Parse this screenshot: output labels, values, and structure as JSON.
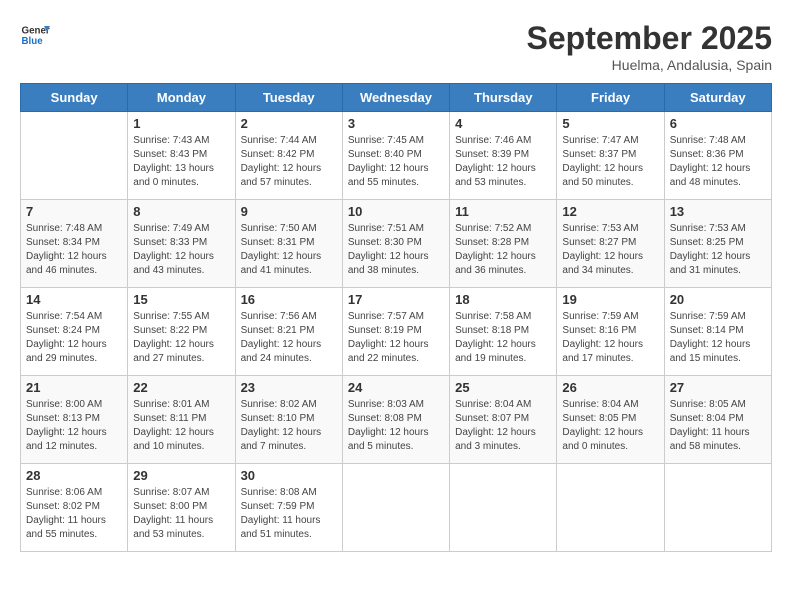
{
  "logo": {
    "line1": "General",
    "line2": "Blue"
  },
  "title": "September 2025",
  "subtitle": "Huelma, Andalusia, Spain",
  "days_header": [
    "Sunday",
    "Monday",
    "Tuesday",
    "Wednesday",
    "Thursday",
    "Friday",
    "Saturday"
  ],
  "weeks": [
    [
      {
        "day": "",
        "sunrise": "",
        "sunset": "",
        "daylight": ""
      },
      {
        "day": "1",
        "sunrise": "Sunrise: 7:43 AM",
        "sunset": "Sunset: 8:43 PM",
        "daylight": "Daylight: 13 hours and 0 minutes."
      },
      {
        "day": "2",
        "sunrise": "Sunrise: 7:44 AM",
        "sunset": "Sunset: 8:42 PM",
        "daylight": "Daylight: 12 hours and 57 minutes."
      },
      {
        "day": "3",
        "sunrise": "Sunrise: 7:45 AM",
        "sunset": "Sunset: 8:40 PM",
        "daylight": "Daylight: 12 hours and 55 minutes."
      },
      {
        "day": "4",
        "sunrise": "Sunrise: 7:46 AM",
        "sunset": "Sunset: 8:39 PM",
        "daylight": "Daylight: 12 hours and 53 minutes."
      },
      {
        "day": "5",
        "sunrise": "Sunrise: 7:47 AM",
        "sunset": "Sunset: 8:37 PM",
        "daylight": "Daylight: 12 hours and 50 minutes."
      },
      {
        "day": "6",
        "sunrise": "Sunrise: 7:48 AM",
        "sunset": "Sunset: 8:36 PM",
        "daylight": "Daylight: 12 hours and 48 minutes."
      }
    ],
    [
      {
        "day": "7",
        "sunrise": "Sunrise: 7:48 AM",
        "sunset": "Sunset: 8:34 PM",
        "daylight": "Daylight: 12 hours and 46 minutes."
      },
      {
        "day": "8",
        "sunrise": "Sunrise: 7:49 AM",
        "sunset": "Sunset: 8:33 PM",
        "daylight": "Daylight: 12 hours and 43 minutes."
      },
      {
        "day": "9",
        "sunrise": "Sunrise: 7:50 AM",
        "sunset": "Sunset: 8:31 PM",
        "daylight": "Daylight: 12 hours and 41 minutes."
      },
      {
        "day": "10",
        "sunrise": "Sunrise: 7:51 AM",
        "sunset": "Sunset: 8:30 PM",
        "daylight": "Daylight: 12 hours and 38 minutes."
      },
      {
        "day": "11",
        "sunrise": "Sunrise: 7:52 AM",
        "sunset": "Sunset: 8:28 PM",
        "daylight": "Daylight: 12 hours and 36 minutes."
      },
      {
        "day": "12",
        "sunrise": "Sunrise: 7:53 AM",
        "sunset": "Sunset: 8:27 PM",
        "daylight": "Daylight: 12 hours and 34 minutes."
      },
      {
        "day": "13",
        "sunrise": "Sunrise: 7:53 AM",
        "sunset": "Sunset: 8:25 PM",
        "daylight": "Daylight: 12 hours and 31 minutes."
      }
    ],
    [
      {
        "day": "14",
        "sunrise": "Sunrise: 7:54 AM",
        "sunset": "Sunset: 8:24 PM",
        "daylight": "Daylight: 12 hours and 29 minutes."
      },
      {
        "day": "15",
        "sunrise": "Sunrise: 7:55 AM",
        "sunset": "Sunset: 8:22 PM",
        "daylight": "Daylight: 12 hours and 27 minutes."
      },
      {
        "day": "16",
        "sunrise": "Sunrise: 7:56 AM",
        "sunset": "Sunset: 8:21 PM",
        "daylight": "Daylight: 12 hours and 24 minutes."
      },
      {
        "day": "17",
        "sunrise": "Sunrise: 7:57 AM",
        "sunset": "Sunset: 8:19 PM",
        "daylight": "Daylight: 12 hours and 22 minutes."
      },
      {
        "day": "18",
        "sunrise": "Sunrise: 7:58 AM",
        "sunset": "Sunset: 8:18 PM",
        "daylight": "Daylight: 12 hours and 19 minutes."
      },
      {
        "day": "19",
        "sunrise": "Sunrise: 7:59 AM",
        "sunset": "Sunset: 8:16 PM",
        "daylight": "Daylight: 12 hours and 17 minutes."
      },
      {
        "day": "20",
        "sunrise": "Sunrise: 7:59 AM",
        "sunset": "Sunset: 8:14 PM",
        "daylight": "Daylight: 12 hours and 15 minutes."
      }
    ],
    [
      {
        "day": "21",
        "sunrise": "Sunrise: 8:00 AM",
        "sunset": "Sunset: 8:13 PM",
        "daylight": "Daylight: 12 hours and 12 minutes."
      },
      {
        "day": "22",
        "sunrise": "Sunrise: 8:01 AM",
        "sunset": "Sunset: 8:11 PM",
        "daylight": "Daylight: 12 hours and 10 minutes."
      },
      {
        "day": "23",
        "sunrise": "Sunrise: 8:02 AM",
        "sunset": "Sunset: 8:10 PM",
        "daylight": "Daylight: 12 hours and 7 minutes."
      },
      {
        "day": "24",
        "sunrise": "Sunrise: 8:03 AM",
        "sunset": "Sunset: 8:08 PM",
        "daylight": "Daylight: 12 hours and 5 minutes."
      },
      {
        "day": "25",
        "sunrise": "Sunrise: 8:04 AM",
        "sunset": "Sunset: 8:07 PM",
        "daylight": "Daylight: 12 hours and 3 minutes."
      },
      {
        "day": "26",
        "sunrise": "Sunrise: 8:04 AM",
        "sunset": "Sunset: 8:05 PM",
        "daylight": "Daylight: 12 hours and 0 minutes."
      },
      {
        "day": "27",
        "sunrise": "Sunrise: 8:05 AM",
        "sunset": "Sunset: 8:04 PM",
        "daylight": "Daylight: 11 hours and 58 minutes."
      }
    ],
    [
      {
        "day": "28",
        "sunrise": "Sunrise: 8:06 AM",
        "sunset": "Sunset: 8:02 PM",
        "daylight": "Daylight: 11 hours and 55 minutes."
      },
      {
        "day": "29",
        "sunrise": "Sunrise: 8:07 AM",
        "sunset": "Sunset: 8:00 PM",
        "daylight": "Daylight: 11 hours and 53 minutes."
      },
      {
        "day": "30",
        "sunrise": "Sunrise: 8:08 AM",
        "sunset": "Sunset: 7:59 PM",
        "daylight": "Daylight: 11 hours and 51 minutes."
      },
      {
        "day": "",
        "sunrise": "",
        "sunset": "",
        "daylight": ""
      },
      {
        "day": "",
        "sunrise": "",
        "sunset": "",
        "daylight": ""
      },
      {
        "day": "",
        "sunrise": "",
        "sunset": "",
        "daylight": ""
      },
      {
        "day": "",
        "sunrise": "",
        "sunset": "",
        "daylight": ""
      }
    ]
  ]
}
